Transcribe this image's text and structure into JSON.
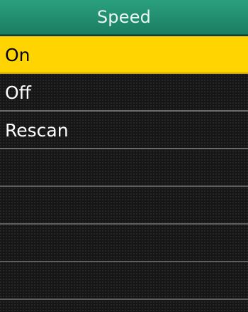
{
  "header": {
    "title": "Speed"
  },
  "menu": {
    "items": [
      {
        "label": "On",
        "selected": true
      },
      {
        "label": "Off",
        "selected": false
      },
      {
        "label": "Rescan",
        "selected": false
      }
    ],
    "empty_rows": 4
  },
  "colors": {
    "header_bg": "#1f8a6b",
    "selected_bg": "#ffd400",
    "text": "#ffffff",
    "background": "#161616"
  }
}
